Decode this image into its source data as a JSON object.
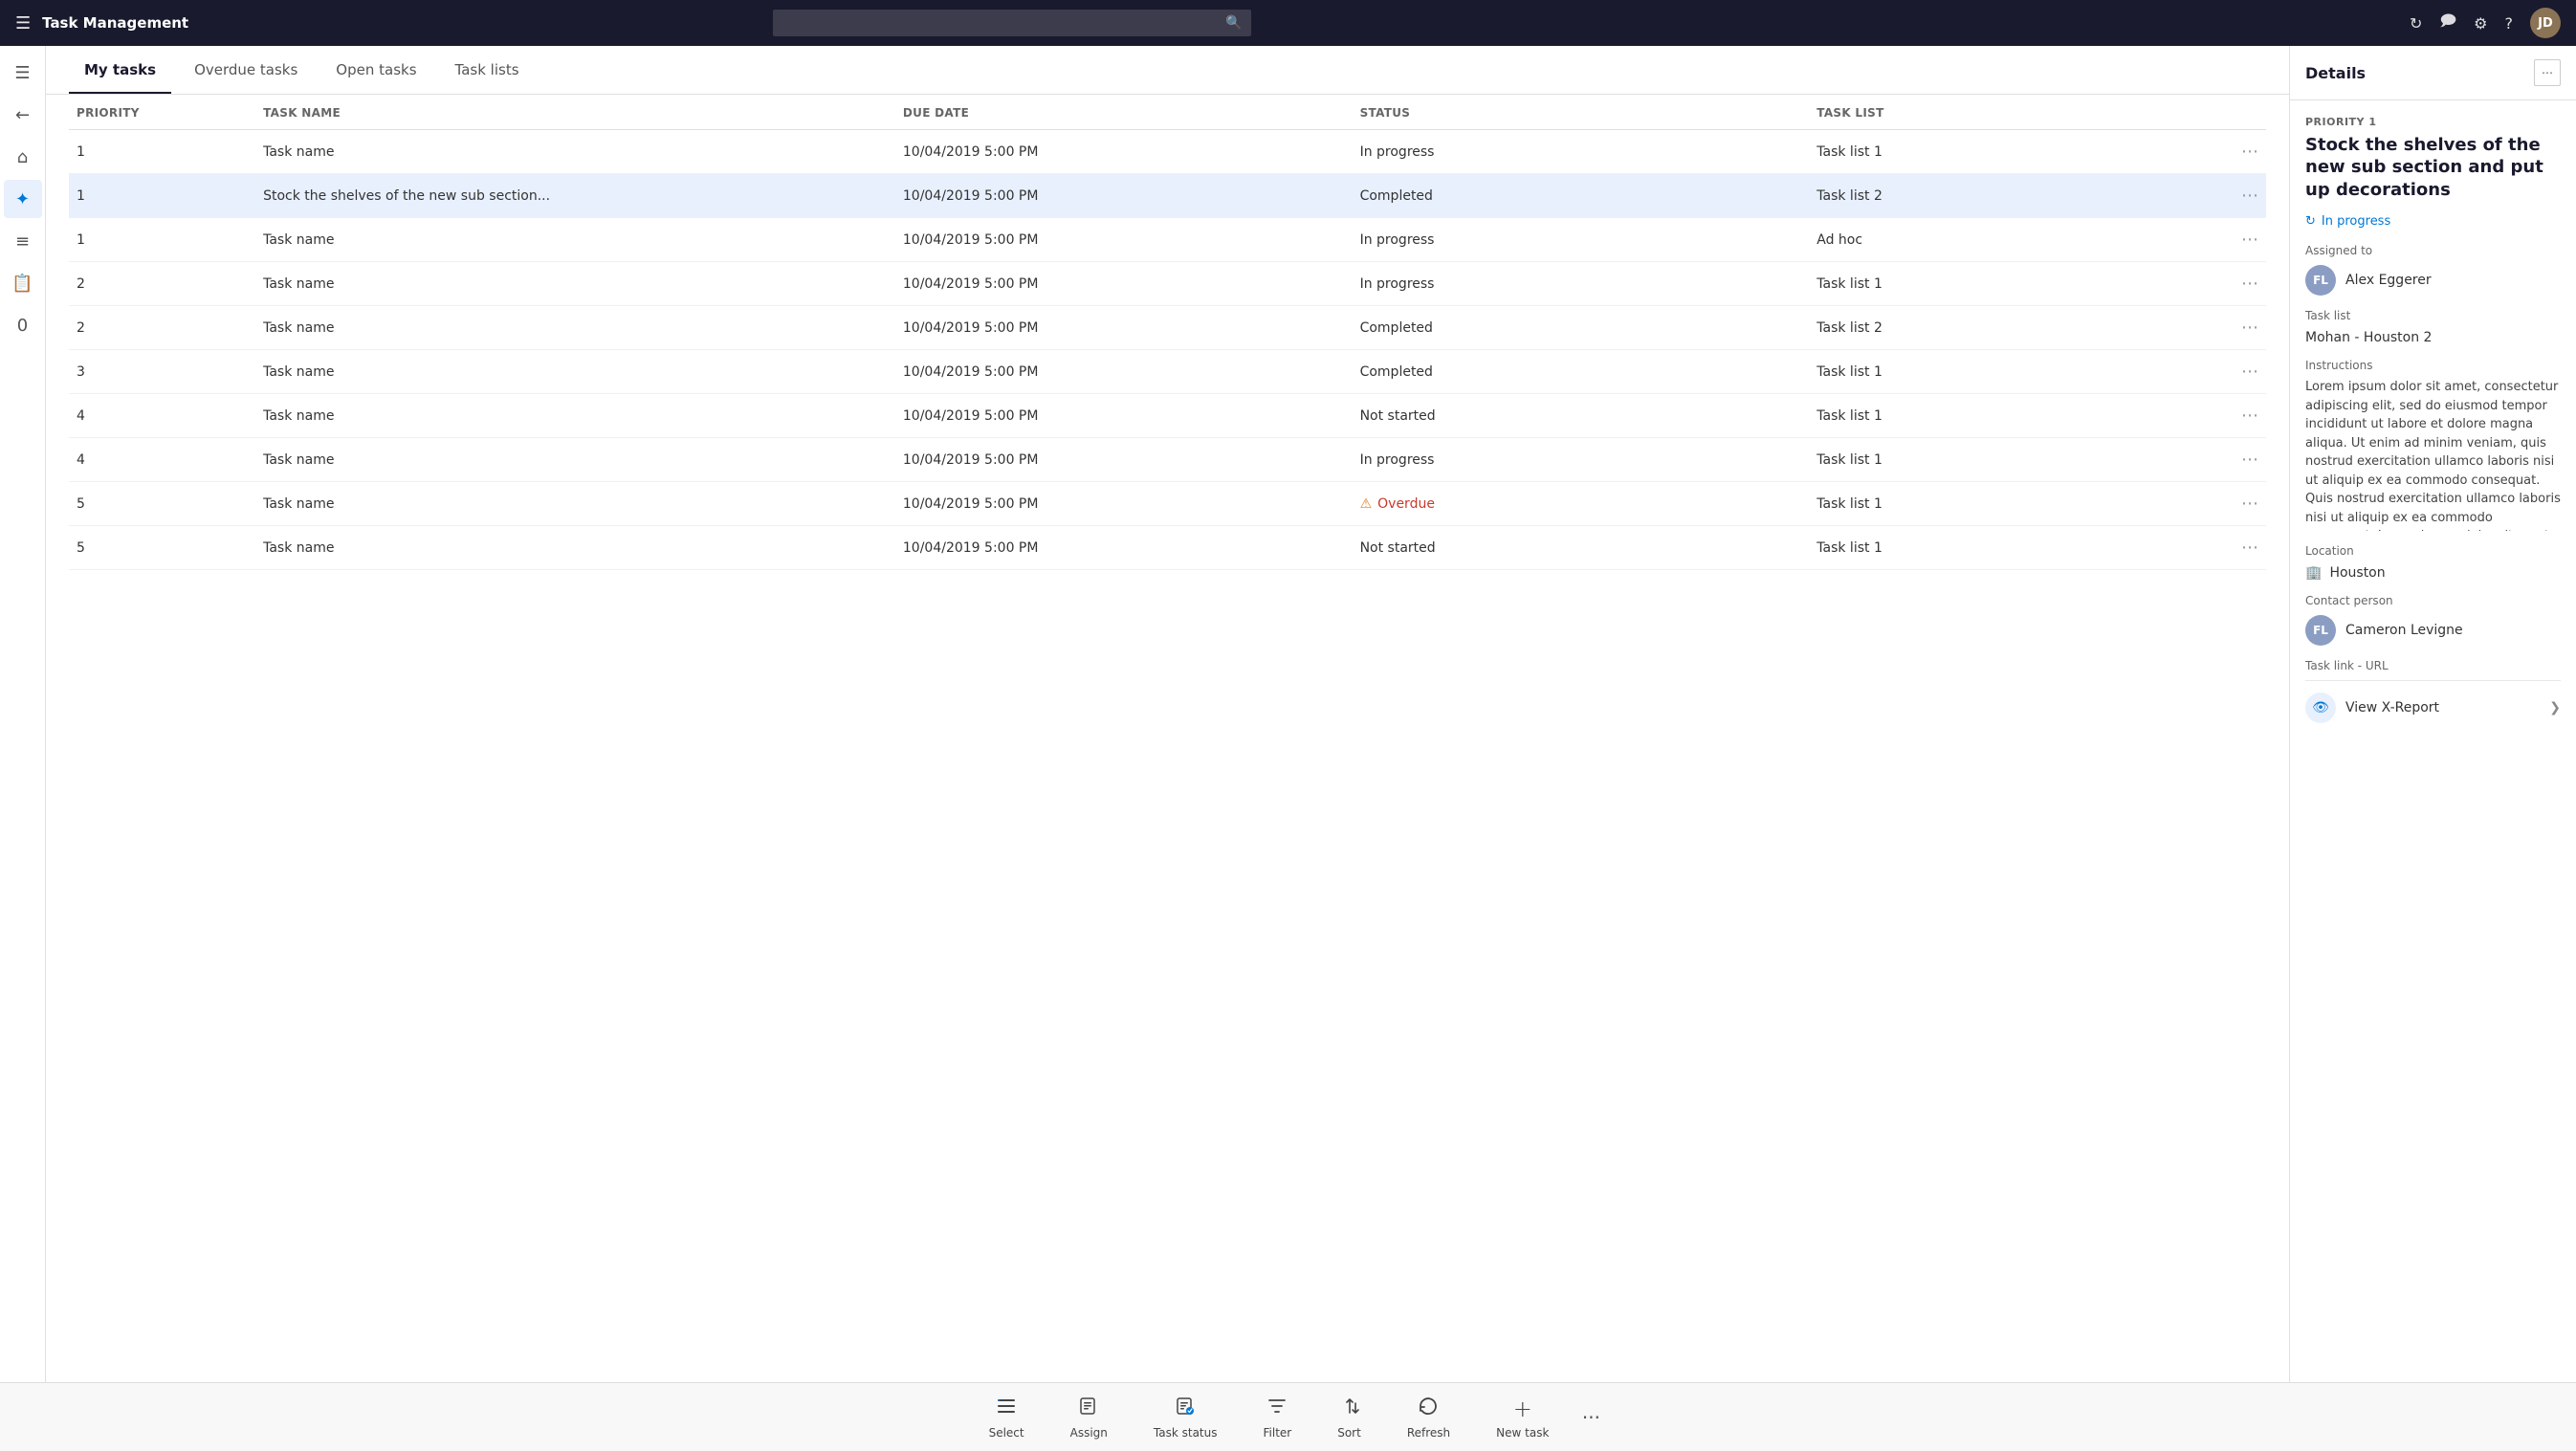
{
  "topbar": {
    "hamburger_icon": "☰",
    "title": "Task Management",
    "search_placeholder": "",
    "search_icon": "🔍",
    "refresh_icon": "↻",
    "chat_icon": "💬",
    "settings_icon": "⚙",
    "help_icon": "?",
    "avatar_initials": "JD"
  },
  "sidebar": {
    "icons": [
      {
        "name": "hamburger",
        "glyph": "☰",
        "active": false
      },
      {
        "name": "back",
        "glyph": "←",
        "active": false
      },
      {
        "name": "home",
        "glyph": "⌂",
        "active": false
      },
      {
        "name": "tasks",
        "glyph": "✦",
        "active": true
      },
      {
        "name": "list",
        "glyph": "≡",
        "active": false
      },
      {
        "name": "clipboard",
        "glyph": "📋",
        "active": false
      },
      {
        "name": "badge",
        "glyph": "0",
        "active": false,
        "badge": "0"
      }
    ]
  },
  "tabs": [
    {
      "label": "My tasks",
      "active": true
    },
    {
      "label": "Overdue tasks",
      "active": false
    },
    {
      "label": "Open tasks",
      "active": false
    },
    {
      "label": "Task lists",
      "active": false
    }
  ],
  "table": {
    "columns": [
      "PRIORITY",
      "TASK NAME",
      "DUE DATE",
      "STATUS",
      "TASK LIST",
      ""
    ],
    "rows": [
      {
        "priority": "1",
        "task_name": "Task name",
        "due_date": "10/04/2019 5:00 PM",
        "status": "In progress",
        "task_list": "Task list 1",
        "status_type": "inprogress"
      },
      {
        "priority": "1",
        "task_name": "Stock the shelves of the new sub section...",
        "due_date": "10/04/2019 5:00 PM",
        "status": "Completed",
        "task_list": "Task list 2",
        "status_type": "completed"
      },
      {
        "priority": "1",
        "task_name": "Task name",
        "due_date": "10/04/2019 5:00 PM",
        "status": "In progress",
        "task_list": "Ad hoc",
        "status_type": "inprogress"
      },
      {
        "priority": "2",
        "task_name": "Task name",
        "due_date": "10/04/2019 5:00 PM",
        "status": "In progress",
        "task_list": "Task list 1",
        "status_type": "inprogress"
      },
      {
        "priority": "2",
        "task_name": "Task name",
        "due_date": "10/04/2019 5:00 PM",
        "status": "Completed",
        "task_list": "Task list 2",
        "status_type": "completed"
      },
      {
        "priority": "3",
        "task_name": "Task name",
        "due_date": "10/04/2019 5:00 PM",
        "status": "Completed",
        "task_list": "Task list 1",
        "status_type": "completed"
      },
      {
        "priority": "4",
        "task_name": "Task name",
        "due_date": "10/04/2019 5:00 PM",
        "status": "Not started",
        "task_list": "Task list 1",
        "status_type": "notstarted"
      },
      {
        "priority": "4",
        "task_name": "Task name",
        "due_date": "10/04/2019 5:00 PM",
        "status": "In progress",
        "task_list": "Task list 1",
        "status_type": "inprogress"
      },
      {
        "priority": "5",
        "task_name": "Task name",
        "due_date": "10/04/2019 5:00 PM",
        "status": "Overdue",
        "task_list": "Task list 1",
        "status_type": "overdue"
      },
      {
        "priority": "5",
        "task_name": "Task name",
        "due_date": "10/04/2019 5:00 PM",
        "status": "Not started",
        "task_list": "Task list 1",
        "status_type": "notstarted"
      }
    ]
  },
  "details": {
    "title": "Details",
    "collapse_icon": "⧉",
    "priority_label": "PRIORITY 1",
    "task_title": "Stock the shelves of the new sub section and put up decorations",
    "status": "In progress",
    "status_icon": "↻",
    "assigned_to_label": "Assigned to",
    "assignee_initials": "FL",
    "assignee_name": "Alex Eggerer",
    "task_list_label": "Task list",
    "task_list_value": "Mohan - Houston 2",
    "instructions_label": "Instructions",
    "instructions_text": "Lorem ipsum dolor sit amet, consectetur adipiscing elit, sed do eiusmod tempor incididunt ut labore et dolore magna aliqua. Ut enim ad minim veniam, quis nostrud exercitation ullamco laboris nisi ut aliquip ex ea commodo consequat. Quis nostrud exercitation ullamco laboris nisi ut aliquip ex ea commodo consequat. Lorem ipsum dolor sit amet, consectetur Quis nostrud exercitation ullamco laboris nisi ut",
    "location_label": "Location",
    "location_icon": "🏢",
    "location_value": "Houston",
    "contact_person_label": "Contact person",
    "contact_initials": "FL",
    "contact_name": "Cameron Levigne",
    "task_link_label": "Task link - URL",
    "view_report_label": "View X-Report",
    "view_report_icon": "👁",
    "chevron_right": "❯"
  },
  "toolbar": {
    "buttons": [
      {
        "name": "select",
        "label": "Select",
        "icon": "☰"
      },
      {
        "name": "assign",
        "label": "Assign",
        "icon": "📋"
      },
      {
        "name": "task-status",
        "label": "Task status",
        "icon": "📊"
      },
      {
        "name": "filter",
        "label": "Filter",
        "icon": "⚡"
      },
      {
        "name": "sort",
        "label": "Sort",
        "icon": "↕"
      },
      {
        "name": "refresh",
        "label": "Refresh",
        "icon": "↺"
      },
      {
        "name": "new-task",
        "label": "New task",
        "icon": "+"
      }
    ],
    "more_icon": "•••"
  }
}
